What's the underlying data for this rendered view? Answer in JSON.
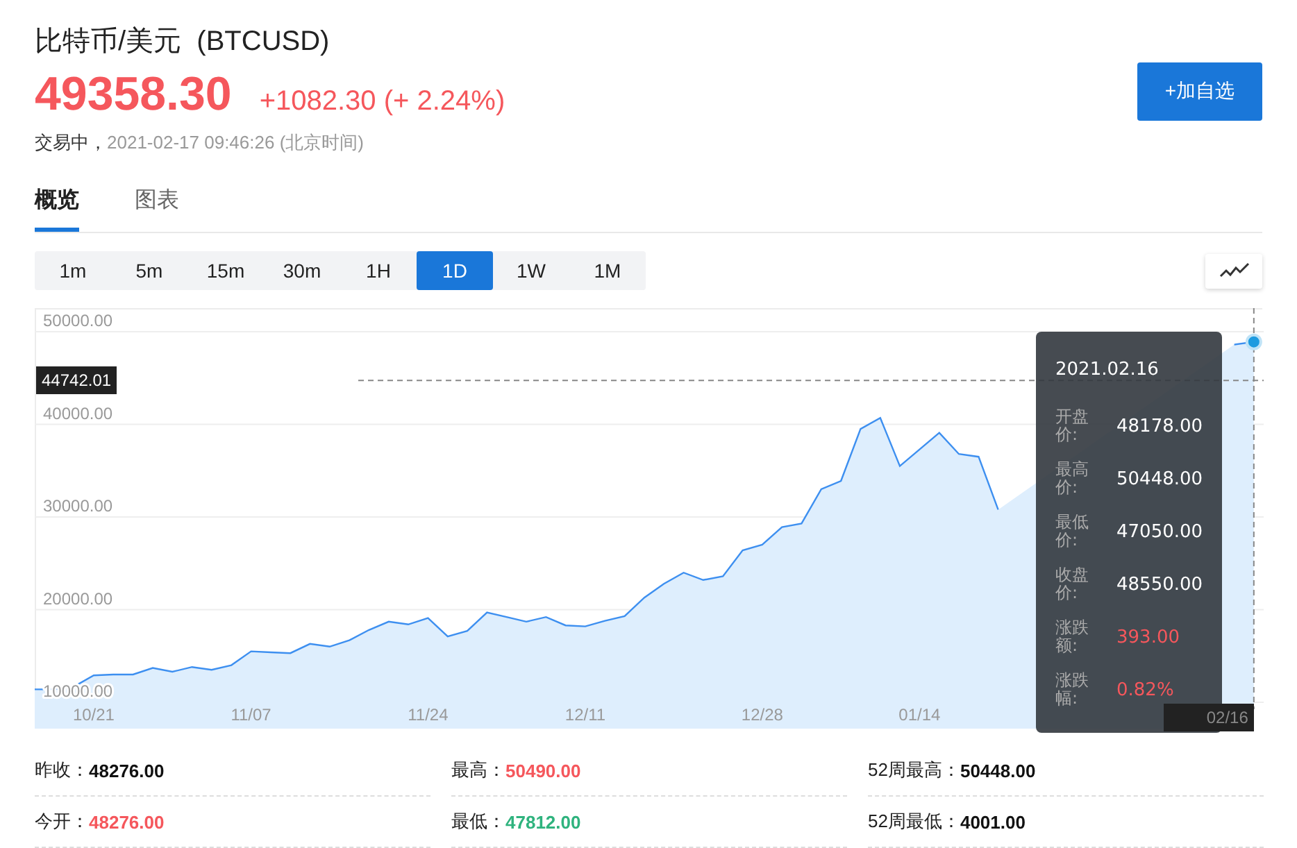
{
  "header": {
    "title": "比特币/美元  (BTCUSD)",
    "price": "49358.30",
    "change": "+1082.30 (+ 2.24%)",
    "status": "交易中，",
    "timestamp": "2021-02-17 09:46:26 (北京时间)",
    "add_button": "+加自选"
  },
  "tabs": [
    {
      "label": "概览",
      "selected": true
    },
    {
      "label": "图表",
      "selected": false
    }
  ],
  "ranges": [
    {
      "label": "1m",
      "selected": false
    },
    {
      "label": "5m",
      "selected": false
    },
    {
      "label": "15m",
      "selected": false
    },
    {
      "label": "30m",
      "selected": false
    },
    {
      "label": "1H",
      "selected": false
    },
    {
      "label": "1D",
      "selected": true
    },
    {
      "label": "1W",
      "selected": false
    },
    {
      "label": "1M",
      "selected": false
    }
  ],
  "chart": {
    "crosshair_date": "02/16",
    "tooltip": {
      "date": "2021.02.16",
      "rows": [
        {
          "label": "开盘价:",
          "value": "48178.00",
          "color": "#ffffff"
        },
        {
          "label": "最高价:",
          "value": "50448.00",
          "color": "#ffffff"
        },
        {
          "label": "最低价:",
          "value": "47050.00",
          "color": "#ffffff"
        },
        {
          "label": "收盘价:",
          "value": "48550.00",
          "color": "#ffffff"
        },
        {
          "label": "涨跌额:",
          "value": "393.00",
          "color": "#f5575c"
        },
        {
          "label": "涨跌幅:",
          "value": "0.82%",
          "color": "#f5575c"
        }
      ]
    },
    "chart_data": {
      "type": "area",
      "ylim": [
        10000,
        50000
      ],
      "grid": true,
      "ref_lines": [
        {
          "axis": "y",
          "value": 44742.01,
          "label": "44742.01"
        }
      ],
      "yticks": [
        {
          "value": 10000,
          "label": "10000.00"
        },
        {
          "value": 20000,
          "label": "20000.00"
        },
        {
          "value": 30000,
          "label": "30000.00"
        },
        {
          "value": 40000,
          "label": "40000.00"
        },
        {
          "value": 50000,
          "label": "50000.00"
        }
      ],
      "categories": [
        null,
        null,
        null,
        "10/21",
        null,
        null,
        null,
        null,
        null,
        null,
        null,
        "11/07",
        null,
        null,
        null,
        null,
        null,
        null,
        null,
        null,
        "11/24",
        null,
        null,
        null,
        null,
        null,
        null,
        null,
        "12/11",
        null,
        null,
        null,
        null,
        null,
        null,
        null,
        null,
        "12/28",
        null,
        null,
        null,
        null,
        null,
        null,
        null,
        "01/14",
        null,
        null,
        null,
        null,
        null,
        null,
        null,
        null,
        null,
        null,
        null,
        null,
        null,
        null,
        null,
        null,
        null
      ],
      "series": [
        {
          "color": "#3d8ff0",
          "values": [
            11400,
            11400,
            11700,
            12900,
            13000,
            13000,
            13700,
            13300,
            13800,
            13500,
            14000,
            15500,
            15400,
            15300,
            16300,
            16000,
            16700,
            17800,
            18700,
            18400,
            19100,
            17100,
            17700,
            19700,
            19200,
            18700,
            19200,
            18300,
            18200,
            18800,
            19300,
            21300,
            22800,
            24000,
            23200,
            23600,
            26400,
            27000,
            28900,
            29300,
            33000,
            33900,
            39500,
            40700,
            35500,
            37300,
            39100,
            36800,
            36500,
            30800,
            null,
            null,
            null,
            null,
            null,
            null,
            null,
            null,
            null,
            null,
            null,
            48600,
            48900
          ]
        }
      ]
    }
  },
  "stats": [
    {
      "label": "昨收：",
      "value": "48276.00",
      "color": "#111111"
    },
    {
      "label": "最高：",
      "value": "50490.00",
      "color": "#f5575c"
    },
    {
      "label": "52周最高：",
      "value": "50448.00",
      "color": "#111111"
    },
    {
      "label": "今开：",
      "value": "48276.00",
      "color": "#f5575c"
    },
    {
      "label": "最低：",
      "value": "47812.00",
      "color": "#2fb37e"
    },
    {
      "label": "52周最低：",
      "value": "4001.00",
      "color": "#111111"
    }
  ]
}
